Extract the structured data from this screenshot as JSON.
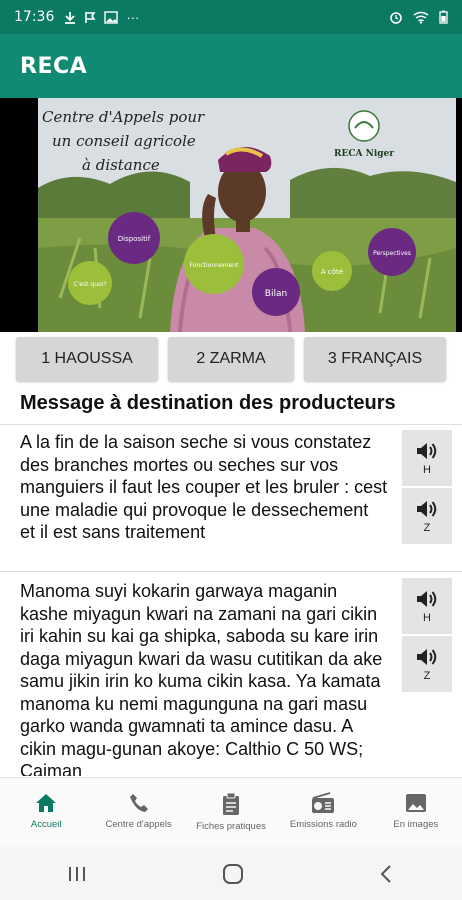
{
  "status_bar": {
    "time": "17:36",
    "left_icons": [
      "download-icon",
      "flag-icon",
      "image-icon",
      "more-icon"
    ],
    "right_icons": [
      "alarm-icon",
      "wifi-icon",
      "battery-icon"
    ]
  },
  "app_bar": {
    "title": "RECA"
  },
  "banner": {
    "caption": "Centre d'Appels pour un conseil agricole à distance",
    "caption_line1": "Centre d'Appels pour",
    "caption_line2": "un conseil agricole",
    "caption_line3": "à distance",
    "logo_text": "RECA Niger",
    "bubbles": [
      "Dispositif",
      "Fonctionnement",
      "Bilan",
      "A côté",
      "Perspectives",
      "C'est quoi?"
    ]
  },
  "languages": [
    "1 HAOUSSA",
    "2 ZARMA",
    "3 FRANÇAIS"
  ],
  "section_title": "Message à destination des producteurs",
  "messages": [
    {
      "text": "A la fin de la saison seche si vous constatez des branches mortes ou seches sur vos manguiers il faut les couper et les bruler : cest une maladie qui provoque le dessechement et il est sans traitement",
      "audio": [
        "H",
        "Z"
      ]
    },
    {
      "text": "Manoma suyi kokarin garwaya maganin kashe miyagun kwari na zamani na gari cikin iri kahin su kai ga shipka, saboda su kare irin daga miyagun kwari da wasu cutitikan da ake samu jikin irin ko kuma cikin kasa. Ya kamata manoma ku nemi magunguna na gari masu garko wanda gwamnati ta amince dasu. A cikin magu-gunan akoye: Calthio C 50 WS; Caiman",
      "audio": [
        "H",
        "Z"
      ]
    }
  ],
  "bottom_nav": [
    {
      "label": "Accueil",
      "icon": "home-icon",
      "active": true
    },
    {
      "label": "Centre d'appels",
      "icon": "phone-icon",
      "active": false
    },
    {
      "label": "Fiches pratiques",
      "icon": "clipboard-icon",
      "active": false
    },
    {
      "label": "Emissions radio",
      "icon": "radio-icon",
      "active": false
    },
    {
      "label": "En images",
      "icon": "photo-icon",
      "active": false
    }
  ],
  "system_nav": [
    "recents-icon",
    "home-circle-icon",
    "back-icon"
  ],
  "colors": {
    "primary": "#118a73",
    "primary_dark": "#0b7a62",
    "button_gray": "#d6d6d6"
  }
}
